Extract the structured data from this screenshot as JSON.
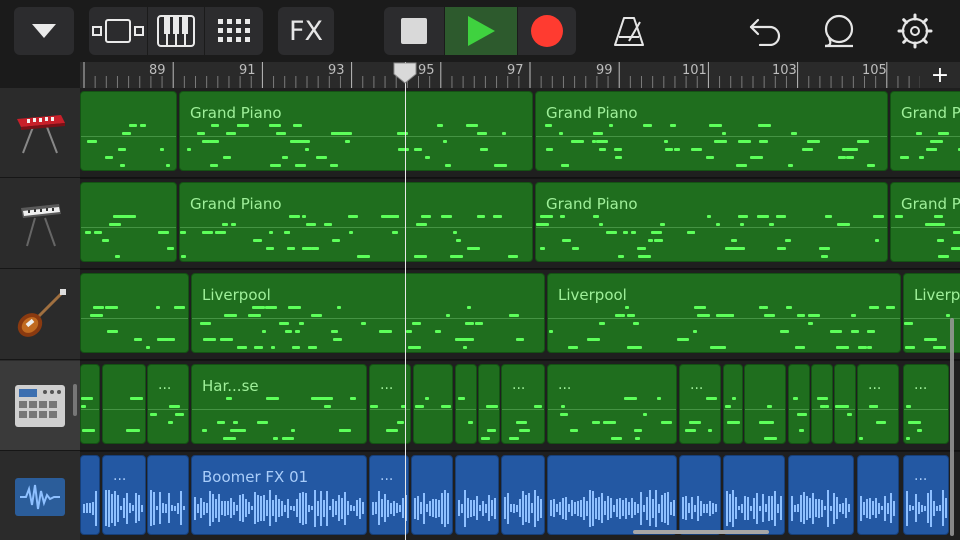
{
  "toolbar": {
    "fx_label": "FX",
    "record_color": "#ff3b30",
    "play_color": "#3fd23f",
    "icons": [
      "browser-menu-icon",
      "tracks-view-icon",
      "keyboard-icon",
      "grid-icon",
      "fx-button",
      "stop-icon",
      "play-icon",
      "record-icon",
      "metronome-icon",
      "undo-icon",
      "loop-icon",
      "settings-icon"
    ]
  },
  "ruler": {
    "bars": [
      "89",
      "91",
      "93",
      "95",
      "97",
      "99",
      "101",
      "103",
      "105"
    ],
    "add_label": "+"
  },
  "tracks": [
    {
      "instrument": "keyboard-synth-icon",
      "regions": [
        {
          "name": "",
          "color": "green"
        },
        {
          "name": "Grand Piano",
          "color": "green"
        },
        {
          "name": "Grand Piano",
          "color": "green"
        },
        {
          "name": "Grand Piano",
          "color": "green"
        }
      ]
    },
    {
      "instrument": "stage-piano-icon",
      "regions": [
        {
          "name": "",
          "color": "green"
        },
        {
          "name": "Grand Piano",
          "color": "green"
        },
        {
          "name": "Grand Piano",
          "color": "green"
        },
        {
          "name": "Grand Piano",
          "color": "green"
        }
      ]
    },
    {
      "instrument": "bass-guitar-icon",
      "regions": [
        {
          "name": "",
          "color": "green"
        },
        {
          "name": "Liverpool",
          "color": "green"
        },
        {
          "name": "Liverpool",
          "color": "green"
        },
        {
          "name": "Liverpool",
          "color": "green"
        }
      ]
    },
    {
      "instrument": "drum-machine-icon",
      "regions": [
        {
          "name": "...",
          "color": "green"
        },
        {
          "name": "Har...se",
          "color": "green"
        },
        {
          "name": "...",
          "color": "green"
        },
        {
          "name": "...",
          "color": "green"
        },
        {
          "name": "...",
          "color": "green"
        },
        {
          "name": "...",
          "color": "green"
        },
        {
          "name": "...",
          "color": "green"
        },
        {
          "name": "...",
          "color": "green"
        }
      ]
    },
    {
      "instrument": "audio-waveform-icon",
      "regions": [
        {
          "name": "...",
          "color": "blue"
        },
        {
          "name": "Boomer FX 01",
          "color": "blue"
        },
        {
          "name": "...",
          "color": "blue"
        },
        {
          "name": "...",
          "color": "blue"
        }
      ]
    }
  ]
}
